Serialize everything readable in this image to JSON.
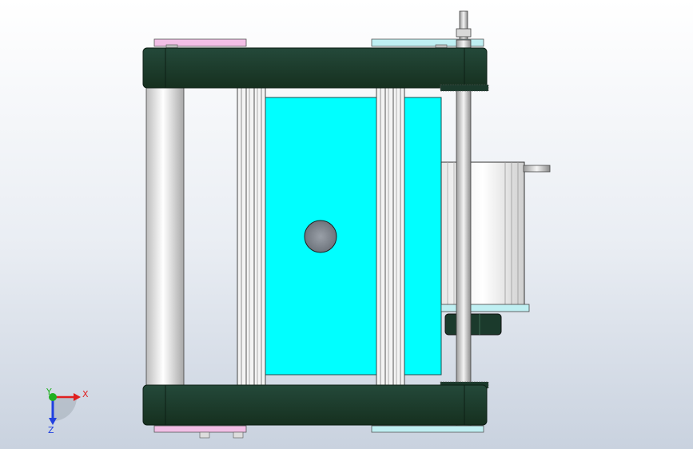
{
  "viewport": {
    "colors": {
      "belt_dark_green": "#1b3a2c",
      "cyan_plate": "#00ffff",
      "pink_plate": "#f2bfe6",
      "light_cyan_plate": "#bfeff2",
      "steel_light": "#f2f2f2",
      "steel_mid": "#c8c8c8",
      "outline": "#222222"
    }
  },
  "triad": {
    "x_label": "X",
    "y_label": "Y",
    "z_label": "Z",
    "x_color": "#e02020",
    "y_color": "#20b020",
    "z_color": "#2040e0"
  }
}
